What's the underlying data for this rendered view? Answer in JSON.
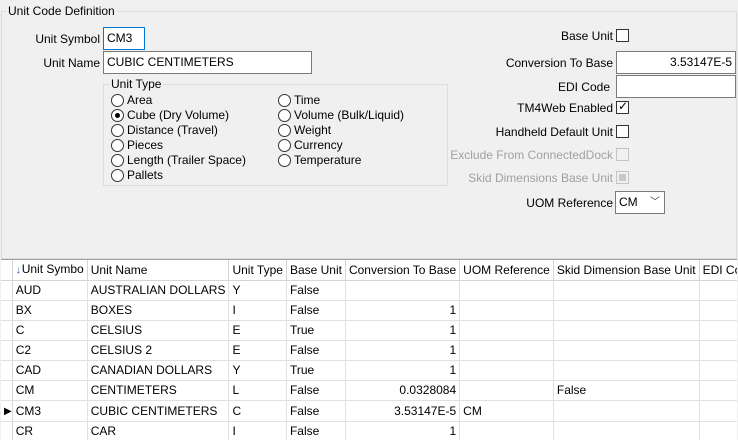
{
  "group": {
    "title": "Unit Code Definition"
  },
  "form": {
    "unit_symbol_label": "Unit Symbol",
    "unit_symbol_value": "CM3",
    "unit_name_label": "Unit Name",
    "unit_name_value": "CUBIC CENTIMETERS",
    "unit_type_title": "Unit Type",
    "unit_types": [
      {
        "label": "Area",
        "selected": false
      },
      {
        "label": "Cube (Dry Volume)",
        "selected": true
      },
      {
        "label": "Distance (Travel)",
        "selected": false
      },
      {
        "label": "Pieces",
        "selected": false
      },
      {
        "label": "Length (Trailer Space)",
        "selected": false
      },
      {
        "label": "Pallets",
        "selected": false
      },
      {
        "label": "Time",
        "selected": false
      },
      {
        "label": "Volume (Bulk/Liquid)",
        "selected": false
      },
      {
        "label": "Weight",
        "selected": false
      },
      {
        "label": "Currency",
        "selected": false
      },
      {
        "label": "Temperature",
        "selected": false
      }
    ],
    "base_unit_label": "Base Unit",
    "base_unit_checked": false,
    "conversion_label": "Conversion To Base",
    "conversion_value": "3.53147E-5",
    "edi_code_label": "EDI Code",
    "edi_code_value": "",
    "tm4web_label": "TM4Web Enabled",
    "tm4web_checked": true,
    "handheld_label": "Handheld Default Unit",
    "handheld_checked": false,
    "exclude_label": "Exclude From ConnectedDock",
    "skid_label": "Skid Dimensions Base Unit",
    "uom_label": "UOM Reference",
    "uom_value": "CM"
  },
  "grid": {
    "columns": [
      "Unit Symbo",
      "Unit Name",
      "Unit Type",
      "Base Unit",
      "Conversion To Base",
      "UOM Reference",
      "Skid Dimension Base Unit",
      "EDI Code"
    ],
    "rows": [
      [
        "AUD",
        "AUSTRALIAN DOLLARS",
        "Y",
        "False",
        "",
        "",
        "",
        ""
      ],
      [
        "BX",
        "BOXES",
        "I",
        "False",
        "1",
        "",
        "",
        ""
      ],
      [
        "C",
        "CELSIUS",
        "E",
        "True",
        "1",
        "",
        "",
        ""
      ],
      [
        "C2",
        "CELSIUS 2",
        "E",
        "False",
        "1",
        "",
        "",
        ""
      ],
      [
        "CAD",
        "CANADIAN DOLLARS",
        "Y",
        "True",
        "1",
        "",
        "",
        ""
      ],
      [
        "CM",
        "CENTIMETERS",
        "L",
        "False",
        "0.0328084",
        "",
        "False",
        ""
      ],
      [
        "CM3",
        "CUBIC CENTIMETERS",
        "C",
        "False",
        "3.53147E-5",
        "CM",
        "",
        ""
      ],
      [
        "CR",
        "CAR",
        "I",
        "False",
        "1",
        "",
        "",
        ""
      ]
    ],
    "current_row": 6
  }
}
